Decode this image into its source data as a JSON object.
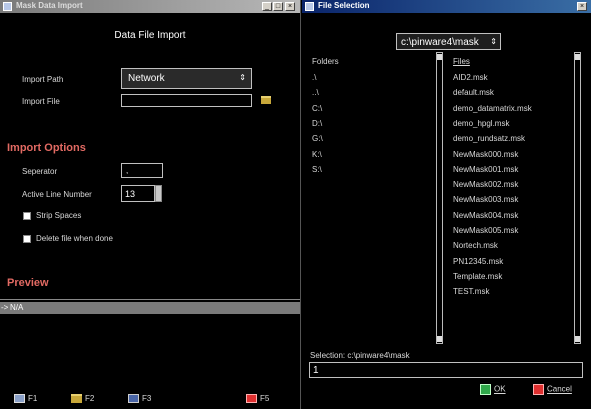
{
  "left": {
    "title": "Mask Data Import",
    "heading": "Data File Import",
    "import_path_label": "Import Path",
    "import_path_value": "Network",
    "import_file_label": "Import File",
    "import_file_value": "",
    "options_heading": "Import Options",
    "separator_label": "Seperator",
    "separator_value": ",",
    "active_line_label": "Active Line Number",
    "active_line_value": "13",
    "strip_spaces_label": "Strip Spaces",
    "delete_file_label": "Delete file when done",
    "preview_heading": "Preview",
    "preview_arrow": "->",
    "preview_text": "N/A",
    "footer": {
      "f1": "F1",
      "f2": "F2",
      "f3": "F3",
      "f5": "F5"
    }
  },
  "right": {
    "title": "File Selection",
    "path_value": "c:\\pinware4\\mask",
    "folders_header": "Folders",
    "folders": [
      ".\\",
      "..\\",
      "C:\\",
      "D:\\",
      "G:\\",
      "K:\\",
      "S:\\"
    ],
    "files_header": "Files",
    "files": [
      "AID2.msk",
      "default.msk",
      "demo_datamatrix.msk",
      "demo_hpgl.msk",
      "demo_rundsatz.msk",
      "NewMask000.msk",
      "NewMask001.msk",
      "NewMask002.msk",
      "NewMask003.msk",
      "NewMask004.msk",
      "NewMask005.msk",
      "Nortech.msk",
      "PN12345.msk",
      "Template.msk",
      "TEST.msk"
    ],
    "selection_label": "Selection:  c:\\pinware4\\mask",
    "selection_value": "1",
    "ok_label": "OK",
    "cancel_label": "Cancel"
  },
  "colors": {
    "section_red": "#e26a63",
    "ok_green": "#2fa84a",
    "cancel_red": "#e03030"
  }
}
